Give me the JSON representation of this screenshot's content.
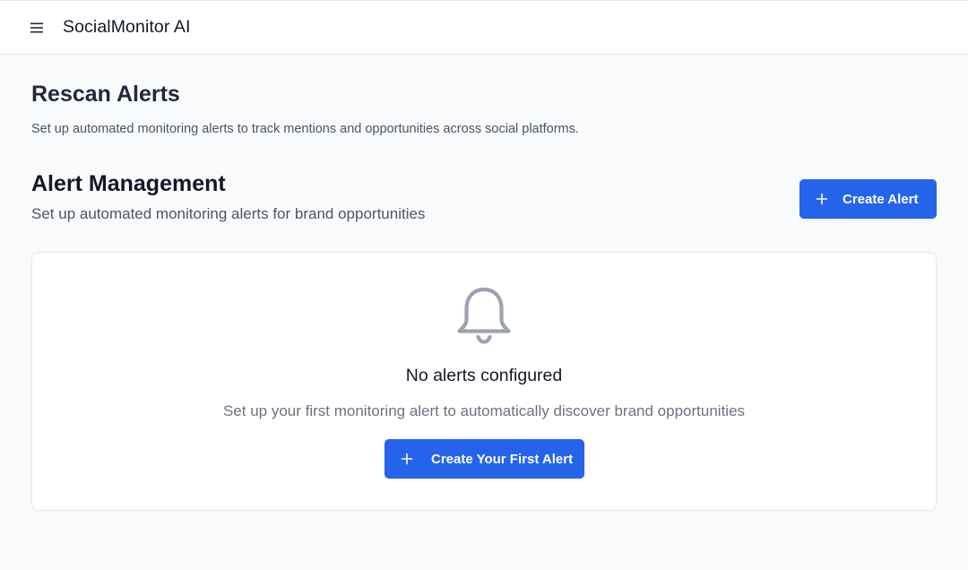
{
  "header": {
    "app_title": "SocialMonitor AI",
    "menu_icon": "hamburger-menu-icon"
  },
  "page": {
    "title": "Rescan Alerts",
    "description": "Set up automated monitoring alerts to track mentions and opportunities across social platforms."
  },
  "section": {
    "title": "Alert Management",
    "description": "Set up automated monitoring alerts for brand opportunities",
    "create_button_label": "Create Alert"
  },
  "empty_state": {
    "icon": "bell-icon",
    "title": "No alerts configured",
    "description": "Set up your first monitoring alert to automatically discover brand opportunities",
    "button_label": "Create Your First Alert"
  },
  "colors": {
    "primary": "#2563eb",
    "background": "#f9fafb",
    "icon_gray": "#9ca3af"
  }
}
